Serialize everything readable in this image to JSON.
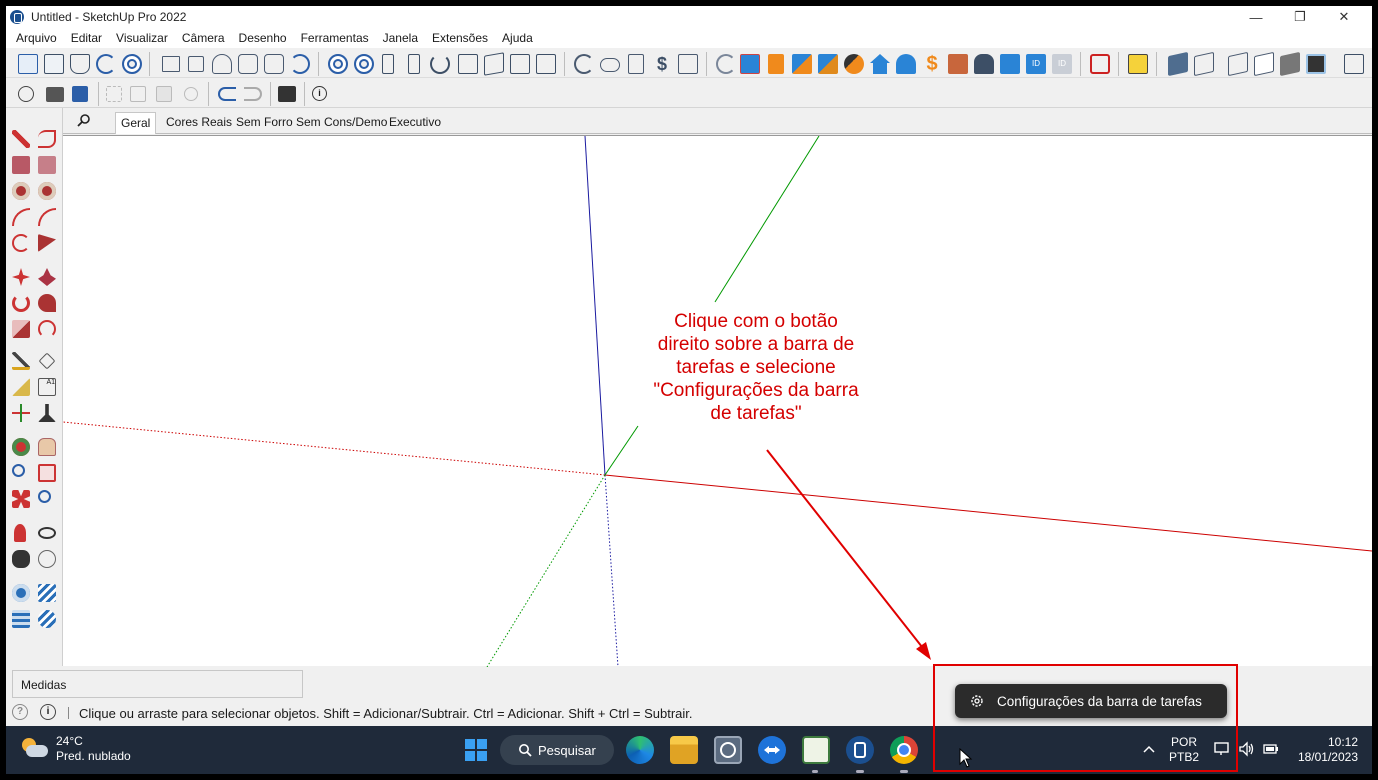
{
  "window": {
    "title": "Untitled - SketchUp Pro 2022"
  },
  "menu": [
    {
      "label": "Arquivo"
    },
    {
      "label": "Editar"
    },
    {
      "label": "Visualizar"
    },
    {
      "label": "Câmera"
    },
    {
      "label": "Desenho"
    },
    {
      "label": "Ferramentas"
    },
    {
      "label": "Janela"
    },
    {
      "label": "Extensões"
    },
    {
      "label": "Ajuda"
    }
  ],
  "scenes": {
    "tabs": [
      "Geral",
      "Cores Reais",
      "Sem Forro",
      "Sem Cons/Demo",
      "Executivo"
    ],
    "active": "Geral"
  },
  "measurements": {
    "label": "Medidas"
  },
  "status": {
    "hint": "Clique ou arraste para selecionar objetos. Shift = Adicionar/Subtrair. Ctrl = Adicionar. Shift + Ctrl = Subtrair."
  },
  "taskbar": {
    "weather_temp": "24°C",
    "weather_desc": "Pred. nublado",
    "search_label": "Pesquisar",
    "lang_top": "POR",
    "lang_bottom": "PTB2",
    "time": "10:12",
    "date": "18/01/2023"
  },
  "context_menu": {
    "item": "Configurações da barra de tarefas"
  },
  "annotation": {
    "line1": "Clique com o botão",
    "line2": "direito sobre a barra de",
    "line3": "tarefas e selecione",
    "line4": "\"Configurações da barra",
    "line5": "de tarefas\""
  },
  "colors": {
    "annotation": "#d40000",
    "axis_red": "#cc0000",
    "axis_green": "#009900",
    "axis_blue": "#1a1aa0",
    "taskbar_bg": "#1f2a3a"
  }
}
